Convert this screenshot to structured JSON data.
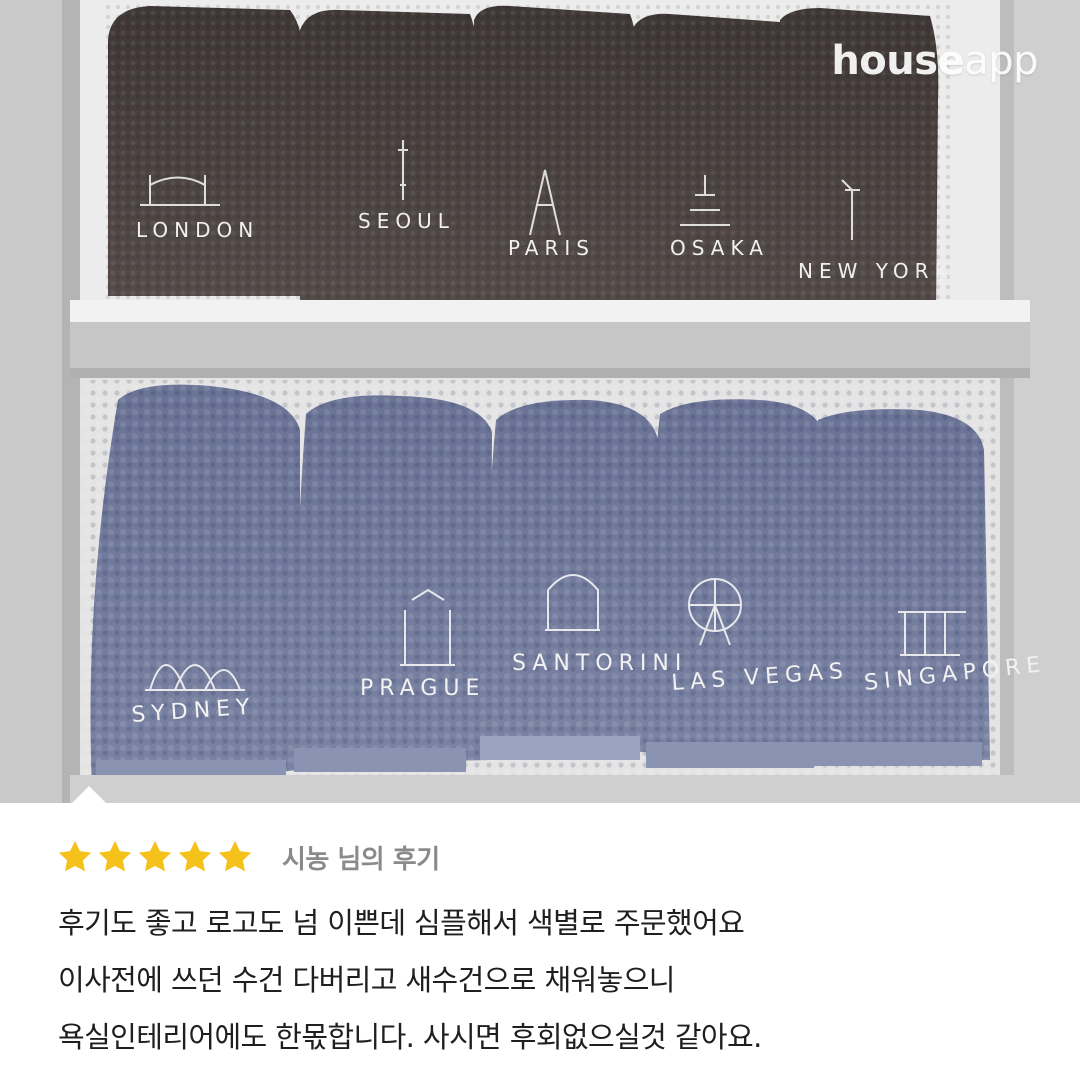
{
  "brand": {
    "name_bold": "house",
    "name_light": "app"
  },
  "photo": {
    "top_shelf_towels": [
      {
        "label": "LONDON",
        "landmark": "tower-bridge-icon"
      },
      {
        "label": "SEOUL",
        "landmark": "namsan-tower-icon"
      },
      {
        "label": "PARIS",
        "landmark": "eiffel-tower-icon"
      },
      {
        "label": "OSAKA",
        "landmark": "osaka-castle-icon"
      },
      {
        "label": "NEW YORK",
        "landmark": "statue-of-liberty-icon"
      }
    ],
    "bottom_shelf_towels": [
      {
        "label": "SYDNEY",
        "landmark": "opera-house-icon"
      },
      {
        "label": "PRAGUE",
        "landmark": "cathedral-icon"
      },
      {
        "label": "SANTORINI",
        "landmark": "domed-temple-icon"
      },
      {
        "label": "LAS VEGAS",
        "landmark": "ferris-wheel-icon"
      },
      {
        "label": "SINGAPORE",
        "landmark": "marina-bay-icon"
      }
    ],
    "colors": {
      "top_towel": "#4a4240",
      "bottom_towel": "#6d7596",
      "shelf": "#e9e9e9"
    }
  },
  "review": {
    "stars": 5,
    "star_color": "#f4c21b",
    "reviewer": "시농 님의 후기",
    "lines": [
      "후기도 좋고 로고도 넘 이쁜데 심플해서 색별로 주문했어요",
      "이사전에 쓰던 수건 다버리고 새수건으로 채워놓으니",
      "욕실인테리어에도 한몫합니다. 사시면 후회없으실것 같아요."
    ]
  }
}
